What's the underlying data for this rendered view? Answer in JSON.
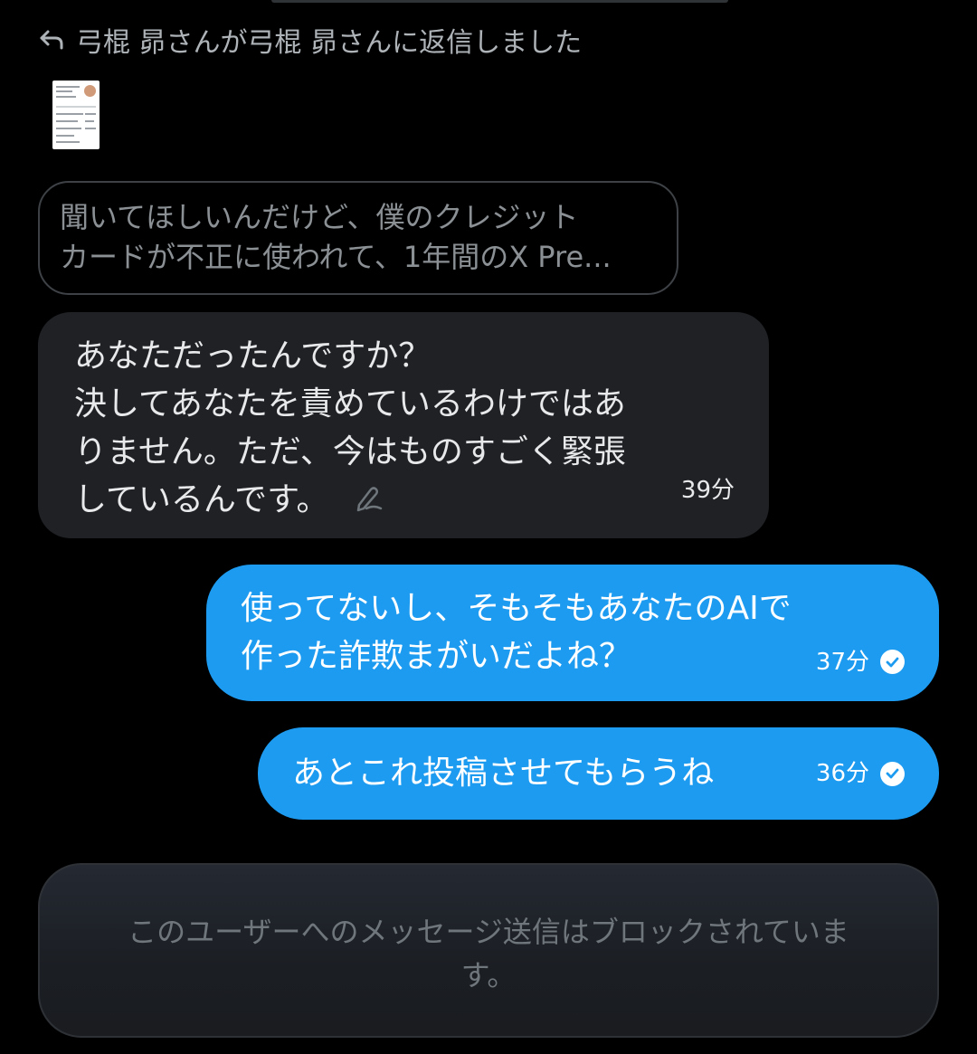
{
  "reply_header": {
    "text": "弓棍 昴さんが弓棍 昴さんに返信しました"
  },
  "quoted_message": {
    "lines": [
      "聞いてほしいんだけど、僕のクレジット",
      "カードが不正に使われて、1年間のX Pre..."
    ]
  },
  "received_message": {
    "lines": [
      "あなただったんですか？",
      "決してあなたを責めているわけではあ",
      "りません。ただ、今はものすごく緊張",
      "しているんです。"
    ],
    "time": "39分",
    "edited": true
  },
  "sent_messages": [
    {
      "lines": [
        "使ってないし、そもそもあなたのAIで",
        "作った詐欺まがいだよね？"
      ],
      "time": "37分",
      "status": "read"
    },
    {
      "lines": [
        "あとこれ投稿させてもらうね"
      ],
      "time": "36分",
      "status": "read"
    }
  ],
  "blocked_notice": {
    "lines": [
      "このユーザーへのメッセージ送信はブロックされていま",
      "す。"
    ]
  },
  "colors": {
    "background": "#000000",
    "sent_bubble": "#1d9bf0",
    "received_bubble": "#1f2125",
    "muted_text": "#8b9095"
  },
  "icons": {
    "reply": "reply-arrow-icon",
    "edited": "edit-pen-icon",
    "read": "check-circle-icon"
  }
}
